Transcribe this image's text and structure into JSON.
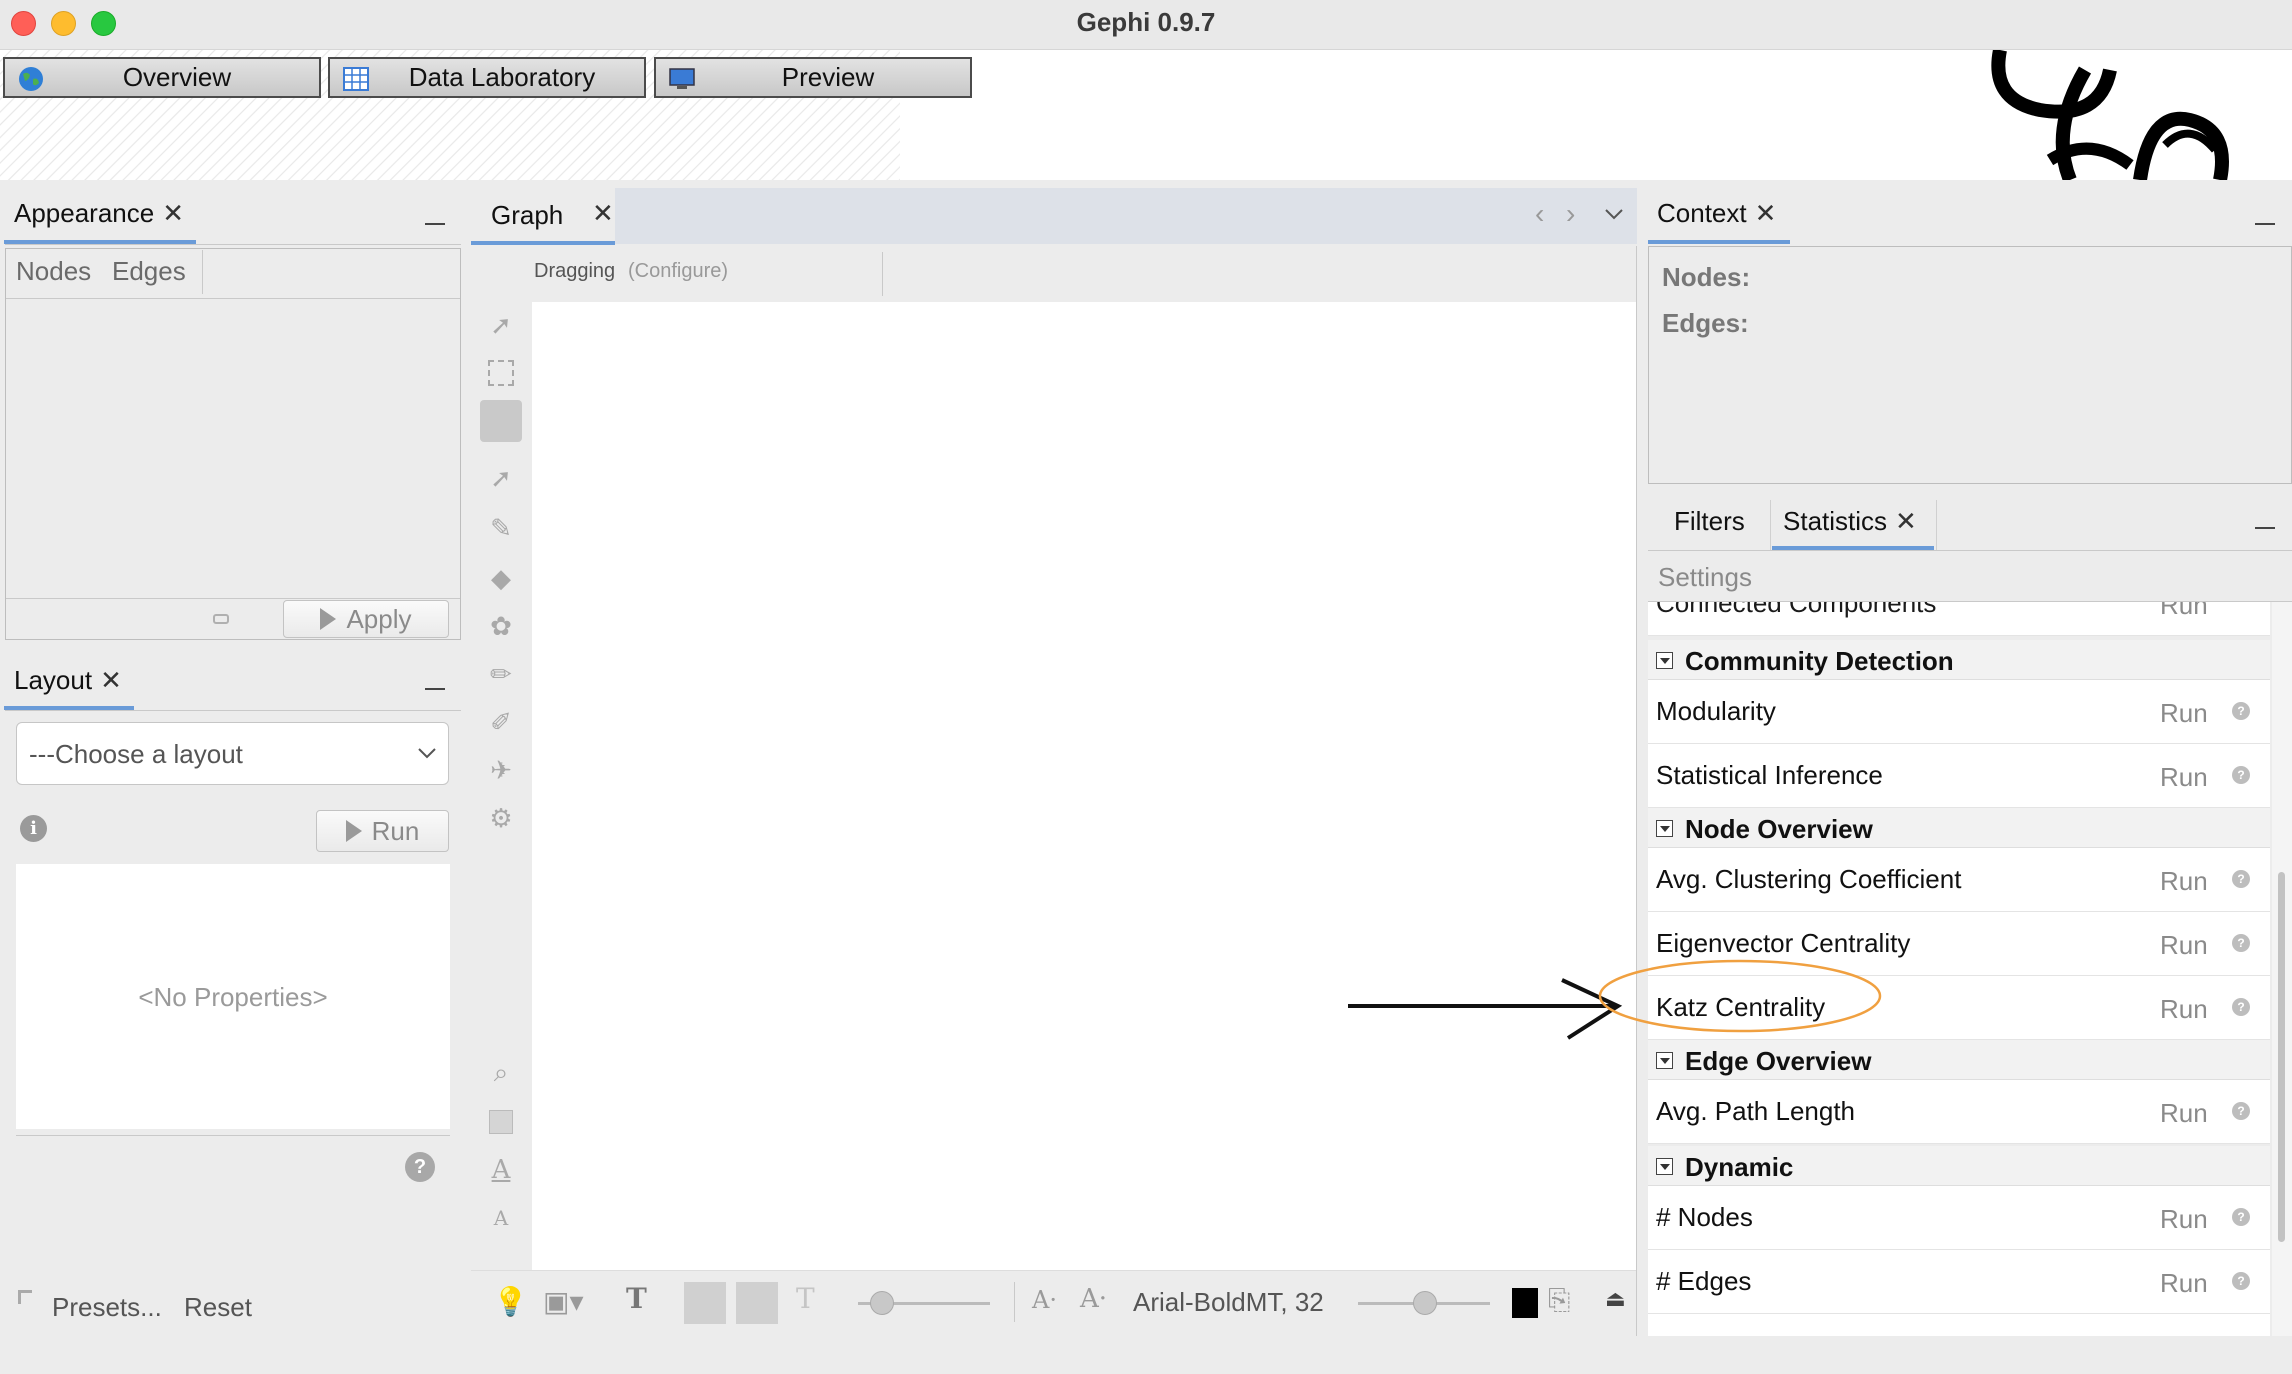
{
  "window": {
    "title": "Gephi 0.9.7"
  },
  "workspace_tabs": [
    {
      "label": "Overview"
    },
    {
      "label": "Data Laboratory"
    },
    {
      "label": "Preview"
    }
  ],
  "appearance": {
    "tab_label": "Appearance",
    "subtabs": [
      "Nodes",
      "Edges"
    ],
    "apply_label": "Apply"
  },
  "layout": {
    "tab_label": "Layout",
    "select_value": "---Choose a layout",
    "run_label": "Run",
    "no_properties": "<No Properties>",
    "presets_label": "Presets...",
    "reset_label": "Reset"
  },
  "graph": {
    "tab_label": "Graph",
    "mode_label": "Dragging",
    "configure_label": "(Configure)",
    "font_label": "Arial-BoldMT, 32"
  },
  "context": {
    "tab_label": "Context",
    "nodes_label": "Nodes:",
    "edges_label": "Edges:"
  },
  "statistics_panel": {
    "filters_tab": "Filters",
    "statistics_tab": "Statistics",
    "settings_label": "Settings",
    "partial_item": "Connected Components",
    "run_label": "Run",
    "categories": [
      {
        "name": "Community Detection",
        "items": [
          "Modularity",
          "Statistical Inference"
        ]
      },
      {
        "name": "Node Overview",
        "items": [
          "Avg. Clustering Coefficient",
          "Eigenvector Centrality",
          "Katz Centrality"
        ]
      },
      {
        "name": "Edge Overview",
        "items": [
          "Avg. Path Length"
        ]
      },
      {
        "name": "Dynamic",
        "items": [
          "# Nodes",
          "# Edges"
        ]
      }
    ]
  },
  "annotation": {
    "highlight_color": "#f0a040",
    "arrow_color": "#111111"
  }
}
